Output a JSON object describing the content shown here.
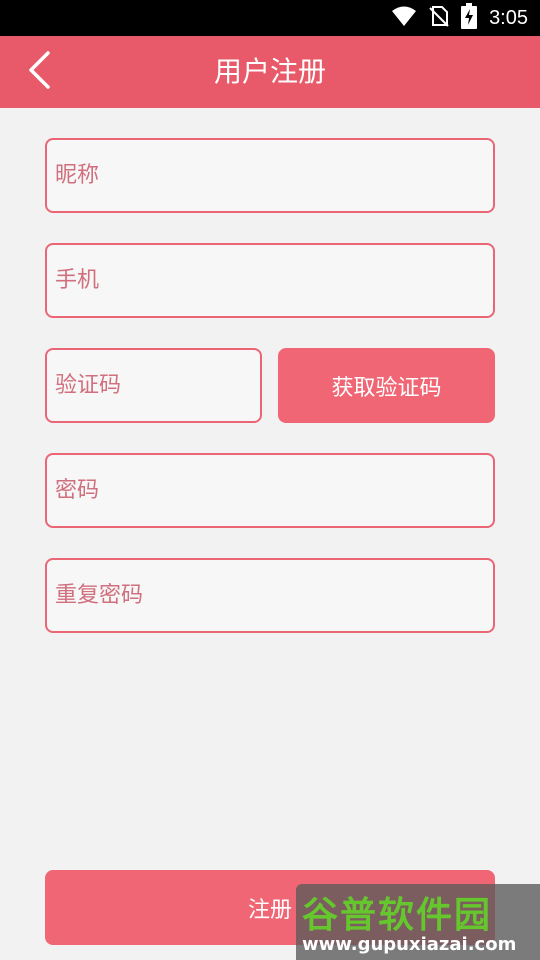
{
  "status_bar": {
    "time": "3:05",
    "icons": [
      "wifi-icon",
      "no-sim-icon",
      "battery-charging-icon"
    ]
  },
  "app_bar": {
    "title": "用户注册",
    "back_icon": "chevron-left-icon"
  },
  "form": {
    "nickname_placeholder": "昵称",
    "phone_placeholder": "手机",
    "code_placeholder": "验证码",
    "get_code_label": "获取验证码",
    "password_placeholder": "密码",
    "confirm_password_placeholder": "重复密码",
    "register_label": "注册"
  },
  "watermark": {
    "brand": "谷普软件园",
    "url": "www.gupuxiazai.com"
  },
  "colors": {
    "accent": "#e85a69",
    "button": "#f16674",
    "field_border": "#ea6675",
    "placeholder": "#d06f7d",
    "background": "#f2f2f2"
  }
}
